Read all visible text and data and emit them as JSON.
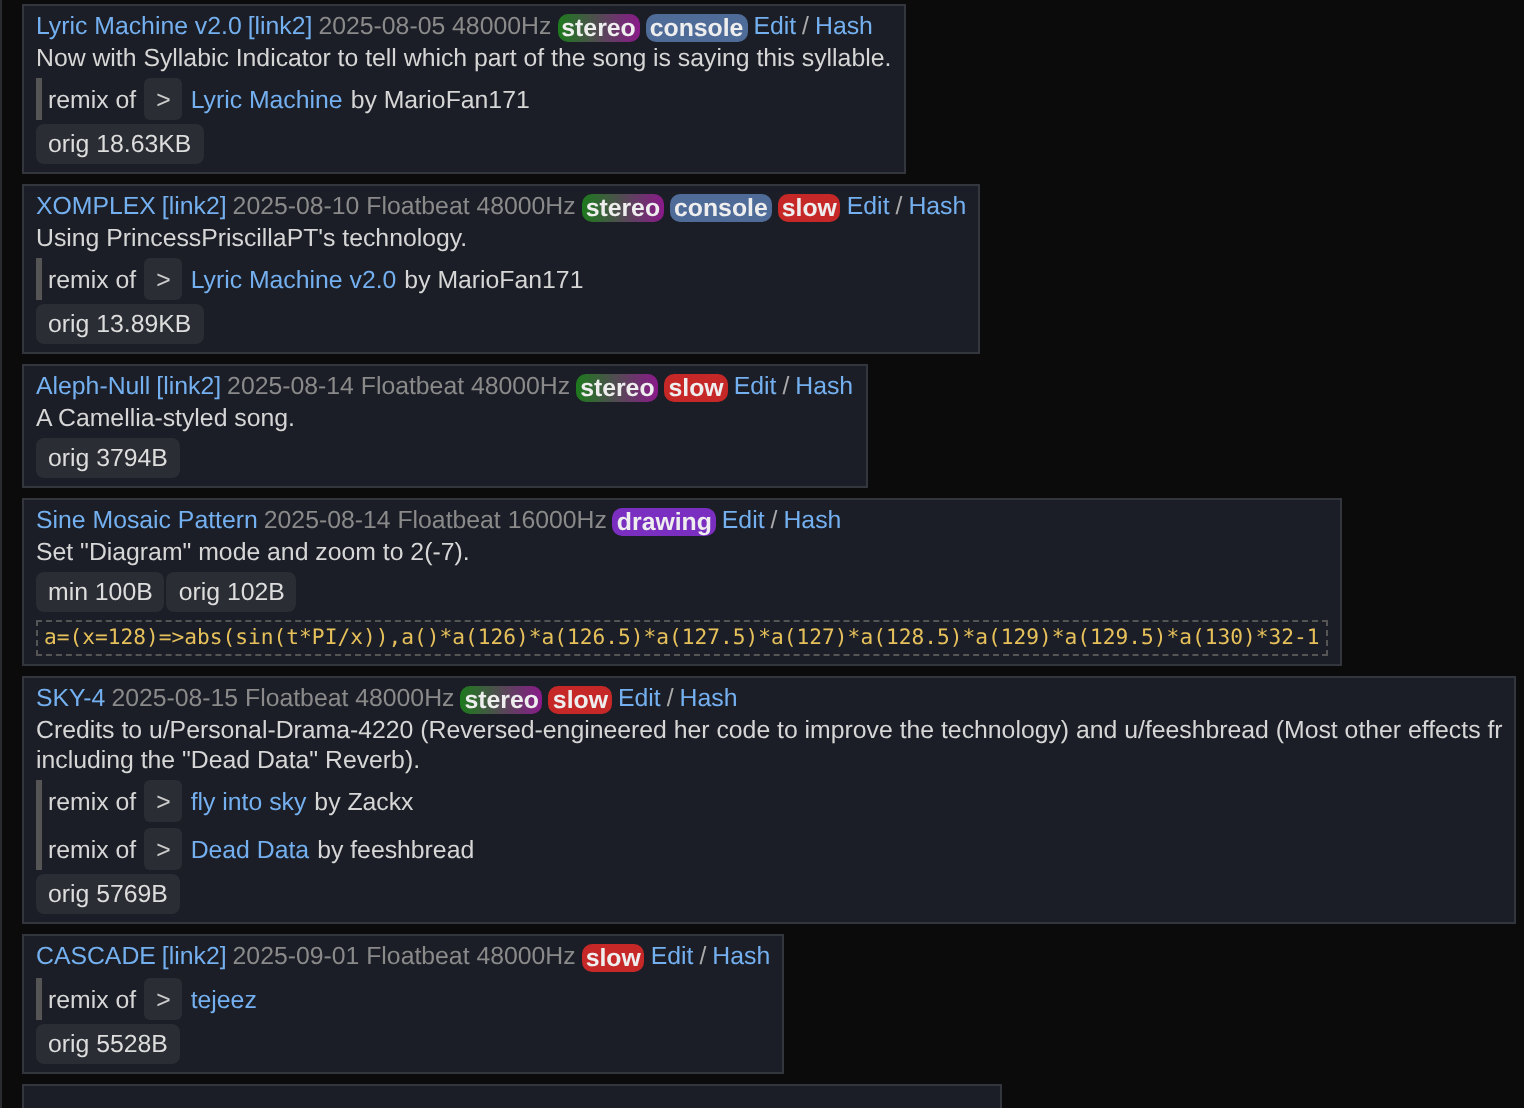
{
  "entries": [
    {
      "title": "Lyric Machine v2.0",
      "link2": "[link2]",
      "meta": "2025-08-05 48000Hz",
      "tags": [
        {
          "label": "stereo",
          "kind": "stereo"
        },
        {
          "label": "console",
          "kind": "console"
        }
      ],
      "edit": "Edit",
      "sep": "/",
      "hash": "Hash",
      "description": [
        "Now with Syllabic Indicator to tell which part of the song is saying this syllable."
      ],
      "remixes": [
        {
          "prefix": "remix of",
          "toggle": ">",
          "song": "Lyric Machine",
          "by": "by MarioFan171"
        }
      ],
      "sizes": [
        "orig 18.63KB"
      ]
    },
    {
      "title": "XOMPLEX",
      "link2": "[link2]",
      "meta": "2025-08-10 Floatbeat 48000Hz",
      "tags": [
        {
          "label": "stereo",
          "kind": "stereo"
        },
        {
          "label": "console",
          "kind": "console"
        },
        {
          "label": "slow",
          "kind": "slow"
        }
      ],
      "edit": "Edit",
      "sep": "/",
      "hash": "Hash",
      "description": [
        "Using PrincessPriscillaPT's technology."
      ],
      "remixes": [
        {
          "prefix": "remix of",
          "toggle": ">",
          "song": "Lyric Machine v2.0",
          "by": "by MarioFan171"
        }
      ],
      "sizes": [
        "orig 13.89KB"
      ]
    },
    {
      "title": "Aleph-Null",
      "link2": "[link2]",
      "meta": "2025-08-14 Floatbeat 48000Hz",
      "tags": [
        {
          "label": "stereo",
          "kind": "stereo"
        },
        {
          "label": "slow",
          "kind": "slow"
        }
      ],
      "edit": "Edit",
      "sep": "/",
      "hash": "Hash",
      "description": [
        "A Camellia-styled song."
      ],
      "sizes": [
        "orig 3794B"
      ]
    },
    {
      "title": "Sine Mosaic Pattern",
      "meta": "2025-08-14 Floatbeat 16000Hz",
      "tags": [
        {
          "label": "drawing",
          "kind": "drawing"
        }
      ],
      "edit": "Edit",
      "sep": "/",
      "hash": "Hash",
      "description": [
        "Set \"Diagram\" mode and zoom to 2(-7)."
      ],
      "sizes": [
        "min 100B",
        "orig 102B"
      ],
      "code": "a=(x=128)=>abs(sin(t*PI/x)),a()*a(126)*a(126.5)*a(127.5)*a(127)*a(128.5)*a(129)*a(129.5)*a(130)*32-1"
    },
    {
      "title": "SKY-4",
      "meta": "2025-08-15 Floatbeat 48000Hz",
      "tags": [
        {
          "label": "stereo",
          "kind": "stereo"
        },
        {
          "label": "slow",
          "kind": "slow"
        }
      ],
      "edit": "Edit",
      "sep": "/",
      "hash": "Hash",
      "description": [
        "Credits to u/Personal-Drama-4220 (Reversed-engineered her code to improve the technology) and u/feeshbread (Most other effects fr",
        "including the \"Dead Data\" Reverb)."
      ],
      "remixes": [
        {
          "prefix": "remix of",
          "toggle": ">",
          "song": "fly into sky",
          "by": "by Zackx"
        },
        {
          "prefix": "remix of",
          "toggle": ">",
          "song": "Dead Data",
          "by": "by feeshbread"
        }
      ],
      "sizes": [
        "orig 5769B"
      ]
    },
    {
      "title": "CASCADE",
      "link2": "[link2]",
      "meta": "2025-09-01 Floatbeat 48000Hz",
      "tags": [
        {
          "label": "slow",
          "kind": "slow"
        }
      ],
      "edit": "Edit",
      "sep": "/",
      "hash": "Hash",
      "remixes": [
        {
          "prefix": "remix of",
          "toggle": ">",
          "song": "tejeez"
        }
      ],
      "sizes": [
        "orig 5528B"
      ]
    }
  ]
}
